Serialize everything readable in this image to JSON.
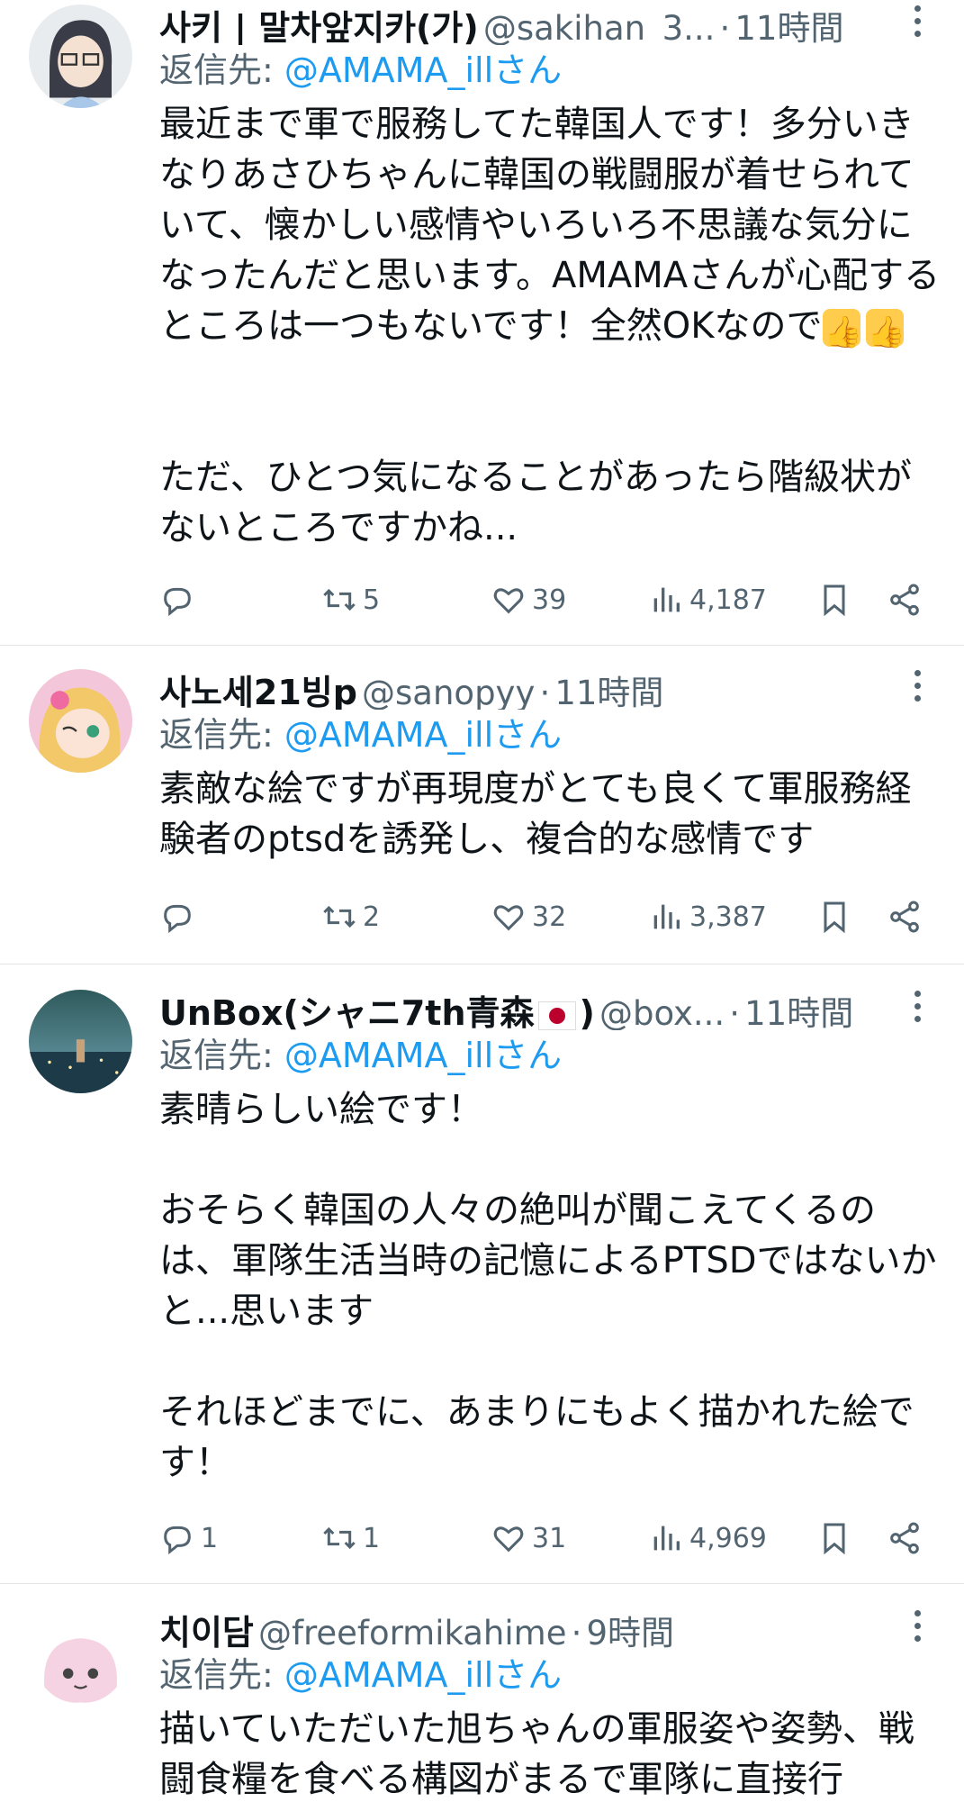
{
  "tweets": [
    {
      "name": "사키 | 말차앞지카(가)",
      "handle": "@sakihan_3...",
      "dot": "·",
      "time": "11時間",
      "reply_prefix": "返信先: ",
      "reply_to": "@AMAMA_illさん",
      "text1": "最近まで軍で服務してた韓国人です！多分いきなりあさひちゃんに韓国の戦闘服が着せられていて、懐かしい感情やいろいろ不思議な気分になったんだと思います。AMAMAさんが心配するところは一つもないです！全然OKなので",
      "text2": "ただ、ひとつ気になることがあったら階級状がないところですかね...",
      "replies": "",
      "retweets": "5",
      "likes": "39",
      "views": "4,187"
    },
    {
      "name": "사노세21빙p",
      "handle": "@sanopyy",
      "dot": "·",
      "time": "11時間",
      "reply_prefix": "返信先: ",
      "reply_to": "@AMAMA_illさん",
      "text1": "素敵な絵ですが再現度がとても良くて軍服務経験者のptsdを誘発し、複合的な感情です",
      "replies": "",
      "retweets": "2",
      "likes": "32",
      "views": "3,387"
    },
    {
      "name": "UnBox(シャニ7th青森",
      "name_suffix": ")",
      "handle": "@box...",
      "dot": "·",
      "time": "11時間",
      "reply_prefix": "返信先: ",
      "reply_to": "@AMAMA_illさん",
      "text1": "素晴らしい絵です！\n\nおそらく韓国の人々の絶叫が聞こえてくるのは、軍隊生活当時の記憶によるPTSDではないかと...思います\n\nそれほどまでに、あまりにもよく描かれた絵です！",
      "replies": "1",
      "retweets": "1",
      "likes": "31",
      "views": "4,969"
    },
    {
      "name": "치이담",
      "handle": "@freeformikahime",
      "dot": "·",
      "time": "9時間",
      "reply_prefix": "返信先: ",
      "reply_to": "@AMAMA_illさん",
      "text1": "描いていただいた旭ちゃんの軍服姿や姿勢、戦闘食糧を食べる構図がまるで軍隊に直接行"
    }
  ],
  "colors": {
    "accent": "#1d9bf0",
    "muted": "#536471",
    "text": "#0f1419"
  },
  "icons": [
    "reply-icon",
    "retweet-icon",
    "like-icon",
    "views-icon",
    "bookmark-icon",
    "share-icon",
    "more-icon"
  ]
}
